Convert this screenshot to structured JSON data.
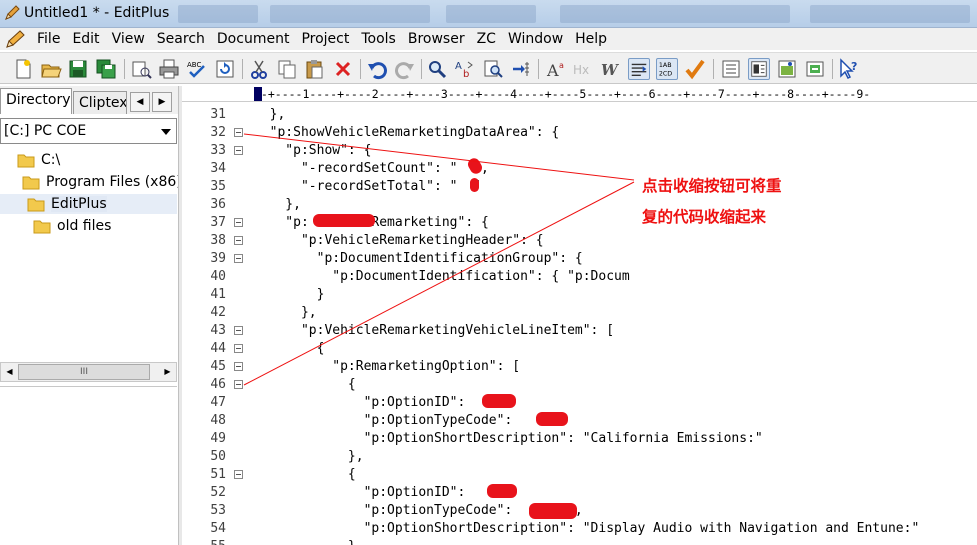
{
  "window": {
    "title": "Untitled1 * - EditPlus"
  },
  "menu": [
    "File",
    "Edit",
    "View",
    "Search",
    "Document",
    "Project",
    "Tools",
    "Browser",
    "ZC",
    "Window",
    "Help"
  ],
  "toolbar": {
    "icons": [
      "new-file-icon",
      "open-folder-icon",
      "save-icon",
      "save-all-icon",
      "print-preview-icon",
      "print-icon",
      "spell-check-icon",
      "refresh-icon",
      "cut-icon",
      "copy-icon",
      "paste-icon",
      "delete-icon",
      "undo-icon",
      "redo-icon",
      "find-icon",
      "replace-icon",
      "find-in-files-icon",
      "goto-line-icon",
      "font-icon",
      "hex-icon",
      "word-wrap-icon",
      "ruler-icon",
      "line-number-icon",
      "check-icon",
      "view-icon",
      "full-screen-icon",
      "browser-icon",
      "clip-icon",
      "help-pointer-icon"
    ]
  },
  "left_panel": {
    "tabs": [
      "Directory",
      "Cliptext"
    ],
    "drive": "[C:] PC COE",
    "folders": [
      {
        "name": "C:\\",
        "indent": 0
      },
      {
        "name": "Program Files (x86)",
        "indent": 1
      },
      {
        "name": "EditPlus",
        "indent": 2,
        "selected": true
      },
      {
        "name": "old files",
        "indent": 3
      }
    ],
    "scroll_thumb": "III"
  },
  "ruler": "--+----1----+----2----+----3----+----4----+----5----+----6----+----7----+----8----+----9-",
  "editor": {
    "lines": [
      {
        "n": "31",
        "fold": false,
        "code": "  },"
      },
      {
        "n": "32",
        "fold": true,
        "code": "  \"p:ShowVehicleRemarketingDataArea\": {"
      },
      {
        "n": "33",
        "fold": true,
        "code": "    \"p:Show\": {"
      },
      {
        "n": "34",
        "fold": false,
        "code": "      \"-recordSetCount\": \"  \","
      },
      {
        "n": "35",
        "fold": false,
        "code": "      \"-recordSetTotal\": \"  \""
      },
      {
        "n": "36",
        "fold": false,
        "code": "    },"
      },
      {
        "n": "37",
        "fold": true,
        "code": "    \"p:        Remarketing\": {"
      },
      {
        "n": "38",
        "fold": true,
        "code": "      \"p:VehicleRemarketingHeader\": {"
      },
      {
        "n": "39",
        "fold": true,
        "code": "        \"p:DocumentIdentificationGroup\": {"
      },
      {
        "n": "40",
        "fold": false,
        "code": "          \"p:DocumentIdentification\": { \"p:Docum"
      },
      {
        "n": "41",
        "fold": false,
        "code": "        }"
      },
      {
        "n": "42",
        "fold": false,
        "code": "      },"
      },
      {
        "n": "43",
        "fold": true,
        "code": "      \"p:VehicleRemarketingVehicleLineItem\": ["
      },
      {
        "n": "44",
        "fold": true,
        "code": "        {"
      },
      {
        "n": "45",
        "fold": true,
        "code": "          \"p:RemarketingOption\": ["
      },
      {
        "n": "46",
        "fold": true,
        "code": "            {"
      },
      {
        "n": "47",
        "fold": false,
        "code": "              \"p:OptionID\":     ,"
      },
      {
        "n": "48",
        "fold": false,
        "code": "              \"p:OptionTypeCode\":     ,"
      },
      {
        "n": "49",
        "fold": false,
        "code": "              \"p:OptionShortDescription\": \"California Emissions:\""
      },
      {
        "n": "50",
        "fold": false,
        "code": "            },"
      },
      {
        "n": "51",
        "fold": true,
        "code": "            {"
      },
      {
        "n": "52",
        "fold": false,
        "code": "              \"p:OptionID\":     ,"
      },
      {
        "n": "53",
        "fold": false,
        "code": "              \"p:OptionTypeCode\":        ,"
      },
      {
        "n": "54",
        "fold": false,
        "code": "              \"p:OptionShortDescription\": \"Display Audio with Navigation and Entune:\""
      },
      {
        "n": "55",
        "fold": false,
        "code": "            }"
      }
    ]
  },
  "annotation": {
    "line1": "点击收缩按钮可将重",
    "line2": "复的代码收缩起来",
    "color": "#e11111"
  }
}
